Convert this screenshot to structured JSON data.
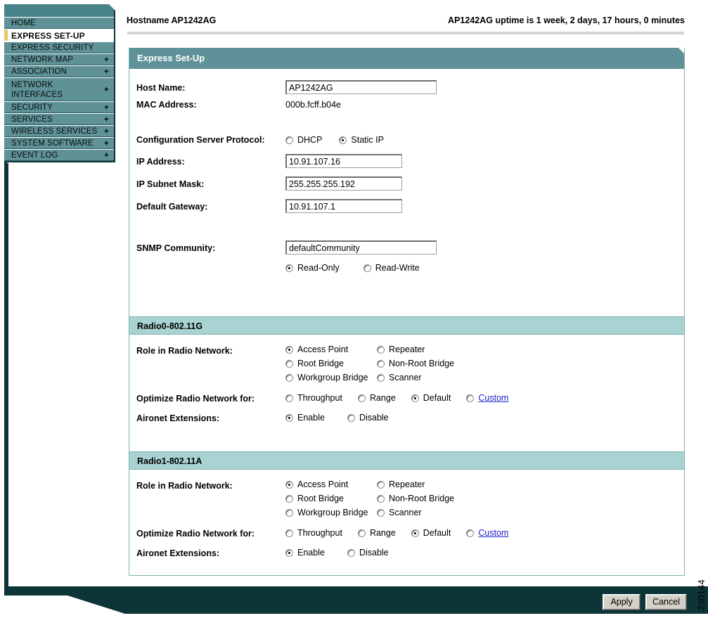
{
  "header": {
    "hostname_label": "Hostname  AP1242AG",
    "uptime": "AP1242AG uptime is 1 week, 2 days, 17 hours, 0 minutes"
  },
  "sidebar": {
    "items": [
      {
        "label": "HOME",
        "expandable": false,
        "active": false
      },
      {
        "label": "EXPRESS SET-UP",
        "expandable": false,
        "active": true
      },
      {
        "label": "EXPRESS SECURITY",
        "expandable": false,
        "active": false
      },
      {
        "label": "NETWORK MAP",
        "expandable": true,
        "active": false
      },
      {
        "label": "ASSOCIATION",
        "expandable": true,
        "active": false
      },
      {
        "label": "NETWORK INTERFACES",
        "label2": "INTERFACES",
        "label1": "NETWORK",
        "expandable": true,
        "active": false,
        "two_line": true
      },
      {
        "label": "SECURITY",
        "expandable": true,
        "active": false
      },
      {
        "label": "SERVICES",
        "expandable": true,
        "active": false
      },
      {
        "label": "WIRELESS SERVICES",
        "expandable": true,
        "active": false
      },
      {
        "label": "SYSTEM SOFTWARE",
        "expandable": true,
        "active": false
      },
      {
        "label": "EVENT LOG",
        "expandable": true,
        "active": false
      }
    ],
    "expand_glyph": "+"
  },
  "panel": {
    "title": "Express Set-Up",
    "host_name_label": "Host Name:",
    "host_name_value": "AP1242AG",
    "mac_address_label": "MAC Address:",
    "mac_address_value": "000b.fcff.b04e",
    "config_proto_label": "Configuration Server Protocol:",
    "config_proto_options": [
      {
        "label": "DHCP",
        "selected": false
      },
      {
        "label": "Static IP",
        "selected": true
      }
    ],
    "ip_address_label": "IP Address:",
    "ip_address_value": "10.91.107.16",
    "subnet_label": "IP Subnet Mask:",
    "subnet_value": "255.255.255.192",
    "gateway_label": "Default Gateway:",
    "gateway_value": "10.91.107.1",
    "snmp_label": "SNMP Community:",
    "snmp_value": "defaultCommunity",
    "snmp_options": [
      {
        "label": "Read-Only",
        "selected": true
      },
      {
        "label": "Read-Write",
        "selected": false
      }
    ]
  },
  "radios": [
    {
      "section_title": "Radio0-802.11G",
      "role_label": "Role in Radio Network:",
      "role_options": [
        {
          "label": "Access Point",
          "selected": true
        },
        {
          "label": "Repeater",
          "selected": false
        },
        {
          "label": "Root Bridge",
          "selected": false
        },
        {
          "label": "Non-Root Bridge",
          "selected": false
        },
        {
          "label": "Workgroup Bridge",
          "selected": false
        },
        {
          "label": "Scanner",
          "selected": false
        }
      ],
      "optimize_label": "Optimize Radio Network for:",
      "optimize_options": [
        {
          "label": "Throughput",
          "selected": false,
          "link": false
        },
        {
          "label": "Range",
          "selected": false,
          "link": false
        },
        {
          "label": "Default",
          "selected": true,
          "link": false
        },
        {
          "label": "Custom",
          "selected": false,
          "link": true
        }
      ],
      "aironet_label": "Aironet Extensions:",
      "aironet_options": [
        {
          "label": "Enable",
          "selected": true
        },
        {
          "label": "Disable",
          "selected": false
        }
      ]
    },
    {
      "section_title": "Radio1-802.11A",
      "role_label": "Role in Radio Network:",
      "role_options": [
        {
          "label": "Access Point",
          "selected": true
        },
        {
          "label": "Repeater",
          "selected": false
        },
        {
          "label": "Root Bridge",
          "selected": false
        },
        {
          "label": "Non-Root Bridge",
          "selected": false
        },
        {
          "label": "Workgroup Bridge",
          "selected": false
        },
        {
          "label": "Scanner",
          "selected": false
        }
      ],
      "optimize_label": "Optimize Radio Network for:",
      "optimize_options": [
        {
          "label": "Throughput",
          "selected": false,
          "link": false
        },
        {
          "label": "Range",
          "selected": false,
          "link": false
        },
        {
          "label": "Default",
          "selected": true,
          "link": false
        },
        {
          "label": "Custom",
          "selected": false,
          "link": true
        }
      ],
      "aironet_label": "Aironet Extensions:",
      "aironet_options": [
        {
          "label": "Enable",
          "selected": true
        },
        {
          "label": "Disable",
          "selected": false
        }
      ]
    }
  ],
  "footer": {
    "apply_label": "Apply",
    "cancel_label": "Cancel",
    "figure_id": "230144"
  },
  "colors": {
    "sidebar_bg": "#5e9297",
    "sidebar_dark": "#0d3538",
    "panel_head": "#5f9298",
    "section_head": "#a9d2d2",
    "accent_yellow": "#e8c76a",
    "link": "#2222cc"
  }
}
